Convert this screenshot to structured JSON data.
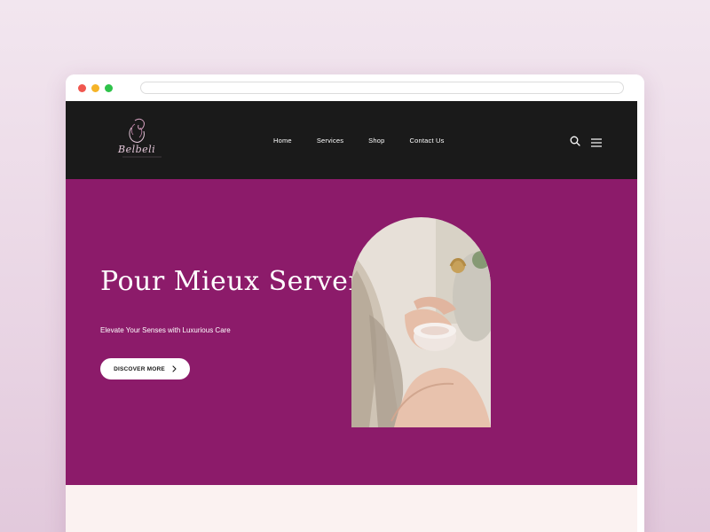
{
  "browser": {
    "controls": [
      "close",
      "minimize",
      "maximize"
    ],
    "url": ""
  },
  "header": {
    "logo_text": "Belbeli",
    "nav": [
      {
        "label": "Home"
      },
      {
        "label": "Services"
      },
      {
        "label": "Shop"
      },
      {
        "label": "Contact Us"
      }
    ],
    "icons": [
      "search-icon",
      "hamburger-menu-icon"
    ]
  },
  "hero": {
    "title": "Pour Mieux Server",
    "subtitle": "Elevate Your Senses with Luxurious Care",
    "cta_label": "DISCOVER MORE",
    "cta_icon": "chevron-right-icon",
    "image": "woman applying body cream from a jar"
  },
  "colors": {
    "nav_bg": "#1a1a1a",
    "hero_bg": "#8c1b6a",
    "section_bg": "#fbf2f1",
    "page_bg": "#ecdbe7"
  }
}
